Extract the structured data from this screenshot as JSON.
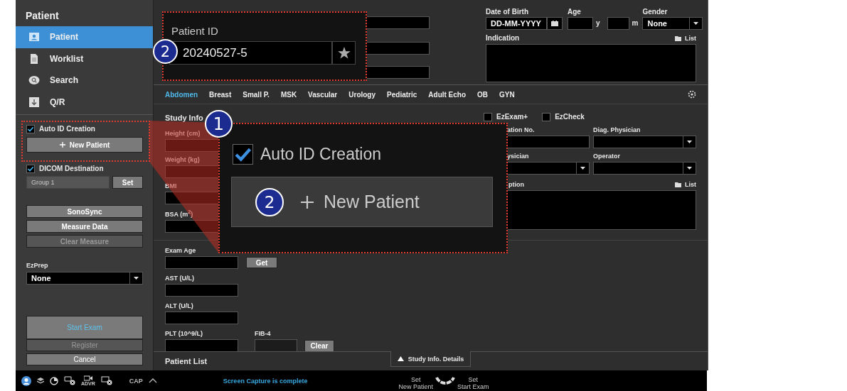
{
  "sidebar": {
    "title": "Patient",
    "nav": [
      {
        "label": "Patient",
        "selected": true
      },
      {
        "label": "Worklist",
        "selected": false
      },
      {
        "label": "Search",
        "selected": false
      },
      {
        "label": "Q/R",
        "selected": false
      }
    ],
    "auto_id": {
      "label": "Auto ID Creation",
      "checked": true
    },
    "new_patient": "New Patient",
    "dicom": {
      "label": "DICOM Destination",
      "checked": true,
      "value": "Group 1",
      "button": "Set"
    },
    "tools": [
      {
        "label": "SonoSync",
        "disabled": false
      },
      {
        "label": "Measure Data",
        "disabled": false
      },
      {
        "label": "Clear Measure",
        "disabled": true
      }
    ],
    "ezprep": {
      "label": "EzPrep",
      "value": "None"
    },
    "actions": [
      {
        "label": "Start Exam",
        "kind": "primary",
        "disabled": false
      },
      {
        "label": "Register",
        "kind": "normal",
        "disabled": true
      },
      {
        "label": "Cancel",
        "kind": "normal",
        "disabled": false
      }
    ]
  },
  "patient_form": {
    "date_of_birth": {
      "label": "Date of Birth",
      "placeholder": "DD-MM-YYYY"
    },
    "age": {
      "label": "Age",
      "units": [
        "y",
        "m"
      ]
    },
    "gender": {
      "label": "Gender",
      "value": "None"
    },
    "indication": {
      "label": "Indication",
      "list": "List"
    }
  },
  "tabs": [
    {
      "label": "Abdomen",
      "selected": true
    },
    {
      "label": "Breast",
      "selected": false
    },
    {
      "label": "Small P.",
      "selected": false
    },
    {
      "label": "MSK",
      "selected": false
    },
    {
      "label": "Vascular",
      "selected": false
    },
    {
      "label": "Urology",
      "selected": false
    },
    {
      "label": "Pediatric",
      "selected": false
    },
    {
      "label": "Adult Echo",
      "selected": false
    },
    {
      "label": "OB",
      "selected": false
    },
    {
      "label": "GYN",
      "selected": false
    }
  ],
  "study_info": {
    "title": "Study Info",
    "measures": [
      {
        "label": "Height (cm)"
      },
      {
        "label": "Weight (kg)"
      },
      {
        "label": "BMI"
      },
      {
        "label": "BSA (m$^{2}$)"
      }
    ],
    "options": [
      {
        "label": "EzExam+",
        "checked": false
      },
      {
        "label": "EzCheck",
        "checked": false
      }
    ],
    "fields": [
      {
        "label": "ation No.",
        "kind": "text"
      },
      {
        "label": "Diag. Physician",
        "kind": "select"
      },
      {
        "label": "ysician",
        "kind": "select"
      },
      {
        "label": "Operator",
        "kind": "select"
      }
    ],
    "description": {
      "label": "ption",
      "list": "List"
    }
  },
  "lab": {
    "exam_age": {
      "label": "Exam Age",
      "button": "Get"
    },
    "tests": [
      {
        "label": "AST (U/L)"
      },
      {
        "label": "ALT (U/L)"
      },
      {
        "label": "PLT (10^9/L)"
      }
    ],
    "fib4": {
      "label": "FIB-4",
      "button": "Clear"
    }
  },
  "patient_list": {
    "title": "Patient List",
    "details": "Study Info. Details"
  },
  "callouts": {
    "patient_id": {
      "badge": "2",
      "label": "Patient ID",
      "value": "20240527-5"
    },
    "auto_id": {
      "badge": "1",
      "label": "Auto ID Creation",
      "checked": true,
      "button": "New Patient",
      "button_badge": "2"
    }
  },
  "status_bar": {
    "dvr": "ADVR",
    "cap": "CAP",
    "message": "Screen Capture is complete",
    "set_left": [
      "Set",
      "New Patient"
    ],
    "set_right": [
      "Set",
      "Start Exam"
    ]
  }
}
